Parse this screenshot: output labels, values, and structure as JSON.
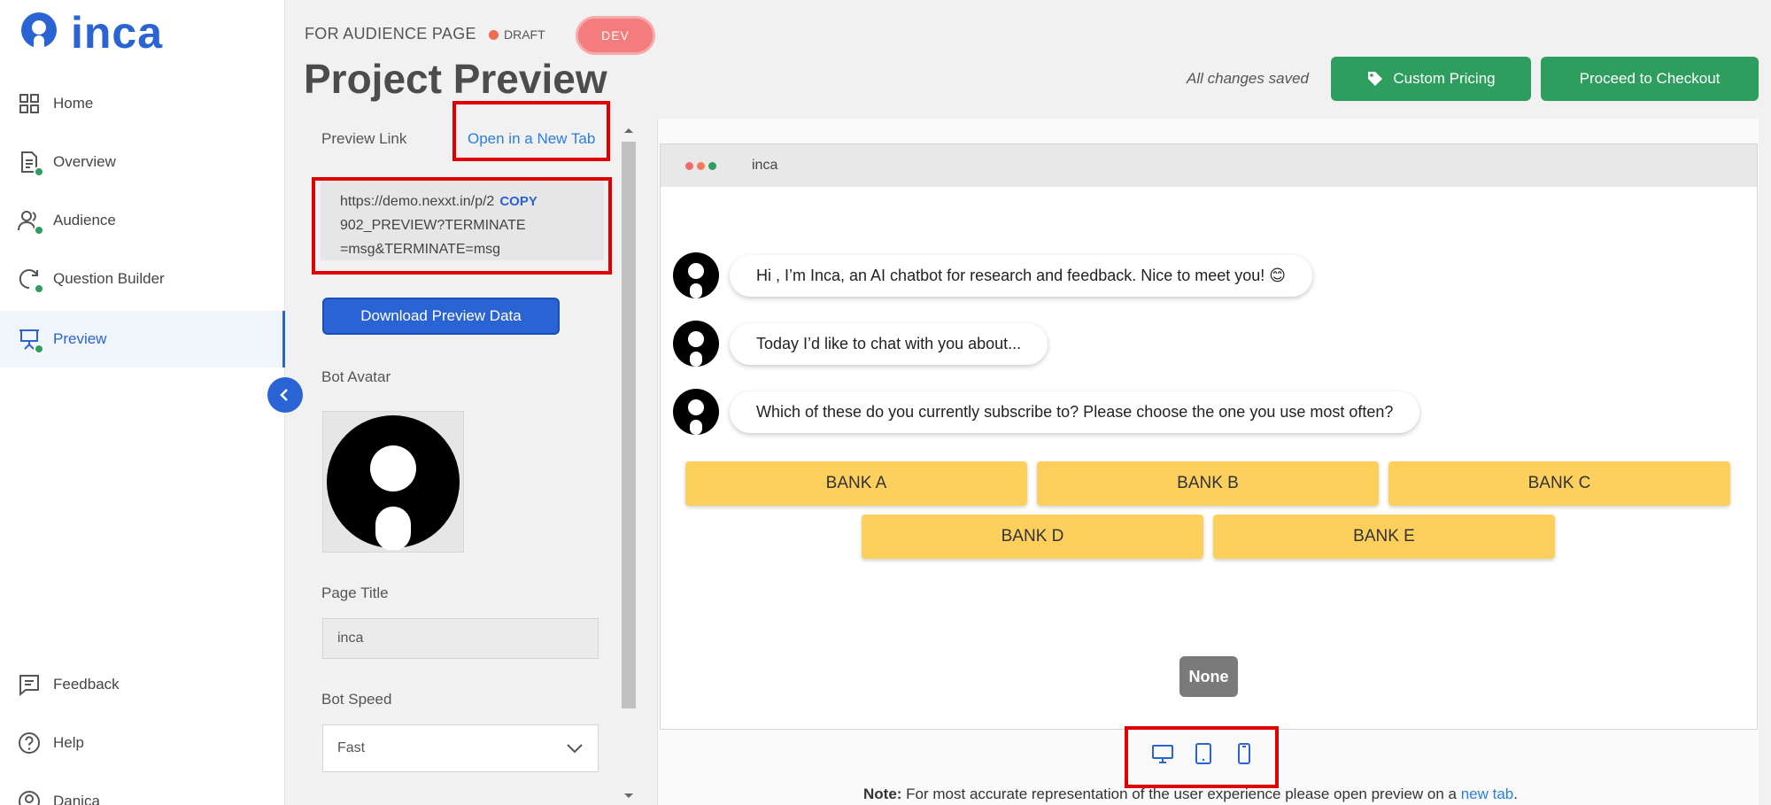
{
  "app": {
    "logo_text": "inca",
    "brand_color": "#2a63d3"
  },
  "sidebar": {
    "items": [
      {
        "label": "Home",
        "icon": "grid-icon"
      },
      {
        "label": "Overview",
        "icon": "document-icon"
      },
      {
        "label": "Audience",
        "icon": "users-icon"
      },
      {
        "label": "Question Builder",
        "icon": "chat-refresh-icon"
      },
      {
        "label": "Preview",
        "icon": "presentation-icon"
      },
      {
        "label": "Feedback",
        "icon": "feedback-icon"
      },
      {
        "label": "Help",
        "icon": "help-icon"
      },
      {
        "label": "Danica",
        "icon": "user-circle-icon"
      }
    ]
  },
  "header": {
    "breadcrumb": "FOR AUDIENCE PAGE",
    "status": "DRAFT",
    "env": "DEV",
    "title": "Project Preview",
    "saved_text": "All changes saved",
    "custom_pricing": "Custom Pricing",
    "checkout": "Proceed to Checkout"
  },
  "settings": {
    "preview_link_label": "Preview Link",
    "open_new_tab": "Open in a New Tab",
    "url_lines": [
      "https://demo.nexxt.in/p/2",
      "902_PREVIEW?TERMINATE",
      "=msg&TERMINATE=msg"
    ],
    "copy": "COPY",
    "download": "Download Preview Data",
    "bot_avatar_label": "Bot Avatar",
    "page_title_label": "Page Title",
    "page_title_value": "inca",
    "bot_speed_label": "Bot Speed",
    "bot_speed_value": "Fast"
  },
  "preview": {
    "tab_title": "inca",
    "messages": [
      "Hi , I’m Inca, an AI chatbot for research and feedback. Nice to meet you! 😊",
      "Today I’d like to chat with you  about...",
      "Which of these do you currently subscribe to? Please choose the one you use most often?"
    ],
    "choices": [
      "BANK A",
      "BANK B",
      "BANK C",
      "BANK D",
      "BANK E"
    ],
    "none_label": "None",
    "choice_color": "#fdd05e"
  },
  "footer": {
    "note_bold": "Note:",
    "note_text": " For most accurate representation of the user experience please open preview on a ",
    "note_link": "new tab",
    "note_end": "."
  }
}
